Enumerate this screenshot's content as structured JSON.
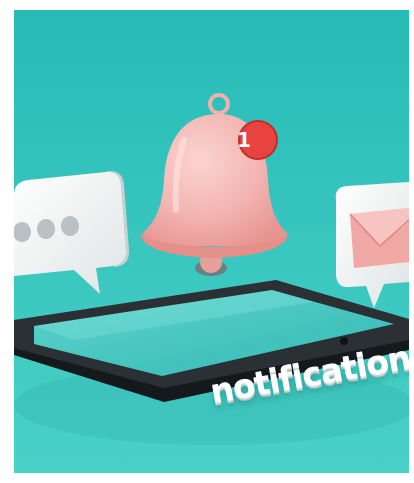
{
  "caption": {
    "text": "notification"
  },
  "badge": {
    "count": "1"
  },
  "colors": {
    "background_top": "#2bbfba",
    "background_bottom": "#46cfc7",
    "bell": "#f3b7b4",
    "badge": "#e8433f",
    "tablet_frame": "#1e2326",
    "tablet_screen": "#3fc2bd",
    "bubble": "#f4f5f5",
    "envelope": "#efa6a2"
  },
  "icons": [
    "bell-icon",
    "chat-bubble-icon",
    "envelope-icon",
    "tablet-icon"
  ]
}
